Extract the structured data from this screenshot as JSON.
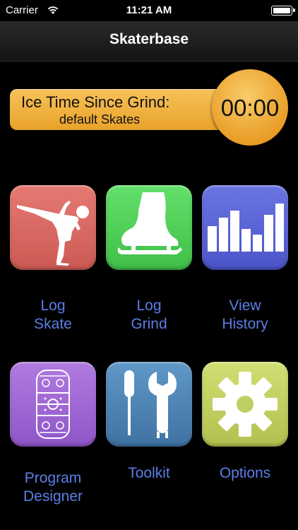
{
  "status_bar": {
    "carrier": "Carrier",
    "time": "11:21 AM"
  },
  "nav": {
    "title": "Skaterbase"
  },
  "ice_time": {
    "title": "Ice Time Since Grind:",
    "skates": "default Skates",
    "timer": "00:00"
  },
  "tiles": [
    {
      "label": "Log\nSkate",
      "icon": "skater-icon",
      "color": "#d9665f"
    },
    {
      "label": "Log\nGrind",
      "icon": "skate-boot-icon",
      "color": "#4fcf58"
    },
    {
      "label": "View\nHistory",
      "icon": "bar-chart-icon",
      "color": "#5a64d6"
    },
    {
      "label": "Program\nDesigner",
      "icon": "rink-icon",
      "color": "#a066d2"
    },
    {
      "label": "Toolkit",
      "icon": "tools-icon",
      "color": "#4f86b5"
    },
    {
      "label": "Options",
      "icon": "gear-icon",
      "color": "#c0cf63"
    }
  ],
  "colors": {
    "label_text": "#5b7ee6",
    "banner": "#f0b040"
  }
}
